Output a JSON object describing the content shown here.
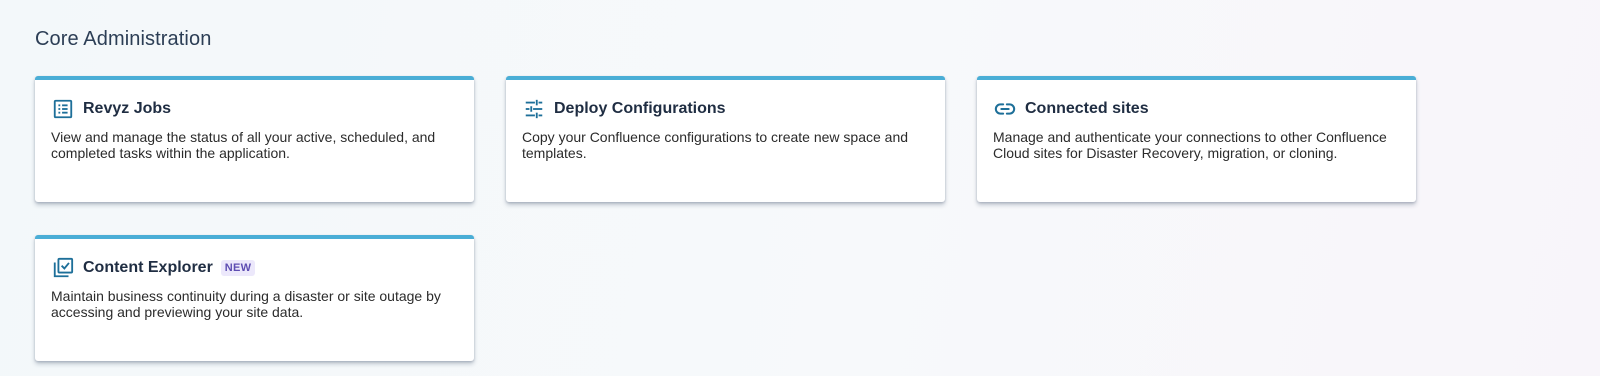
{
  "section": {
    "title": "Core Administration"
  },
  "cards": [
    {
      "title": "Revyz Jobs",
      "description": "View and manage the status of all your active, scheduled, and completed tasks within the application.",
      "icon": "task-list-icon"
    },
    {
      "title": "Deploy Configurations",
      "description": "Copy your Confluence configurations to create new space and templates.",
      "icon": "sliders-icon"
    },
    {
      "title": "Connected sites",
      "description": "Manage and authenticate your connections to other Confluence Cloud sites for Disaster Recovery, migration, or cloning.",
      "icon": "link-icon"
    },
    {
      "title": "Content Explorer",
      "badge": "NEW",
      "description": "Maintain business continuity during a disaster or site outage by accessing and previewing your site data.",
      "icon": "library-check-icon"
    }
  ],
  "colors": {
    "accent": "#4aaed6",
    "icon": "#1d6f99",
    "badge_bg": "#ece8fb",
    "badge_text": "#5e4db2"
  }
}
